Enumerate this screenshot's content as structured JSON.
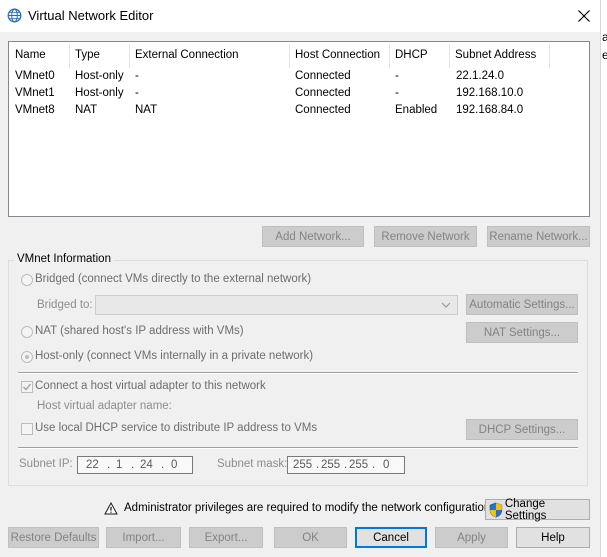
{
  "window": {
    "title": "Virtual Network Editor",
    "right_strip_chars": [
      "a",
      "e"
    ]
  },
  "network_list": {
    "columns": [
      "Name",
      "Type",
      "External Connection",
      "Host Connection",
      "DHCP",
      "Subnet Address"
    ],
    "rows": [
      [
        "VMnet0",
        "Host-only",
        "-",
        "Connected",
        "-",
        "22.1.24.0"
      ],
      [
        "VMnet1",
        "Host-only",
        "-",
        "Connected",
        "-",
        "192.168.10.0"
      ],
      [
        "VMnet8",
        "NAT",
        "NAT",
        "Connected",
        "Enabled",
        "192.168.84.0"
      ]
    ]
  },
  "network_buttons": {
    "add": "Add Network...",
    "remove": "Remove Network",
    "rename": "Rename Network..."
  },
  "vmnet_info": {
    "title": "VMnet Information",
    "bridged_label": "Bridged (connect VMs directly to the external network)",
    "bridged_to_label": "Bridged to:",
    "bridged_to_value": "",
    "automatic_settings": "Automatic Settings...",
    "nat_label": "NAT (shared host's IP address with VMs)",
    "nat_settings": "NAT Settings...",
    "hostonly_label": "Host-only (connect VMs internally in a private network)",
    "selected_mode": "Host-only",
    "connect_adapter_label": "Connect a host virtual adapter to this network",
    "connect_adapter_checked": true,
    "adapter_name_label": "Host virtual adapter name:",
    "dhcp_label": "Use local DHCP service to distribute IP address to VMs",
    "dhcp_checked": false,
    "dhcp_settings": "DHCP Settings...",
    "subnet_ip_label": "Subnet IP:",
    "subnet_ip": [
      "22",
      "1",
      "24",
      "0"
    ],
    "subnet_mask_label": "Subnet mask:",
    "subnet_mask": [
      "255",
      "255",
      "255",
      "0"
    ]
  },
  "admin": {
    "warning": "Administrator privileges are required to modify the network configuration.",
    "change_settings": "Change Settings"
  },
  "footer": {
    "restore": "Restore Defaults",
    "import": "Import...",
    "export": "Export...",
    "ok": "OK",
    "cancel": "Cancel",
    "apply": "Apply",
    "help": "Help"
  },
  "colors": {
    "background": "#f0f0f0",
    "disabled_text": "#6d6d6d",
    "focus_border": "#0078d7",
    "shield_blue": "#2a6fcf",
    "shield_yellow": "#f5c400"
  },
  "icons": [
    "network-globe-icon",
    "close-icon",
    "warning-icon",
    "shield-icon",
    "chevron-down-icon"
  ]
}
